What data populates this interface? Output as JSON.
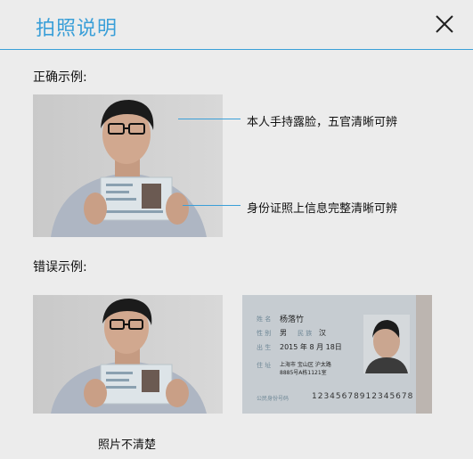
{
  "dialog": {
    "title": "拍照说明"
  },
  "correct": {
    "label": "正确示例:",
    "annotations": [
      "本人手持露脸，五官清晰可辨",
      "身份证照上信息完整清晰可辨"
    ]
  },
  "wrong": {
    "label": "错误示例:",
    "captions": [
      "照片不清楚"
    ]
  },
  "id_card": {
    "name_label": "姓 名",
    "name_value": "杨落竹",
    "gender_label": "性 别",
    "gender_value": "男",
    "ethnicity_label": "民 族",
    "ethnicity_value": "汉",
    "birth_label": "出 生",
    "birth_value": "2015 年 8 月 18日",
    "address_label": "住 址",
    "address_line1": "上海市 宝山区 沪太路",
    "address_line2": "8885号A栋1121室",
    "id_label": "公民身份号码",
    "id_number": "12345678912345678"
  },
  "colors": {
    "accent": "#3a9fd8",
    "background": "#ececec"
  },
  "icons": {
    "close": "close-icon"
  }
}
